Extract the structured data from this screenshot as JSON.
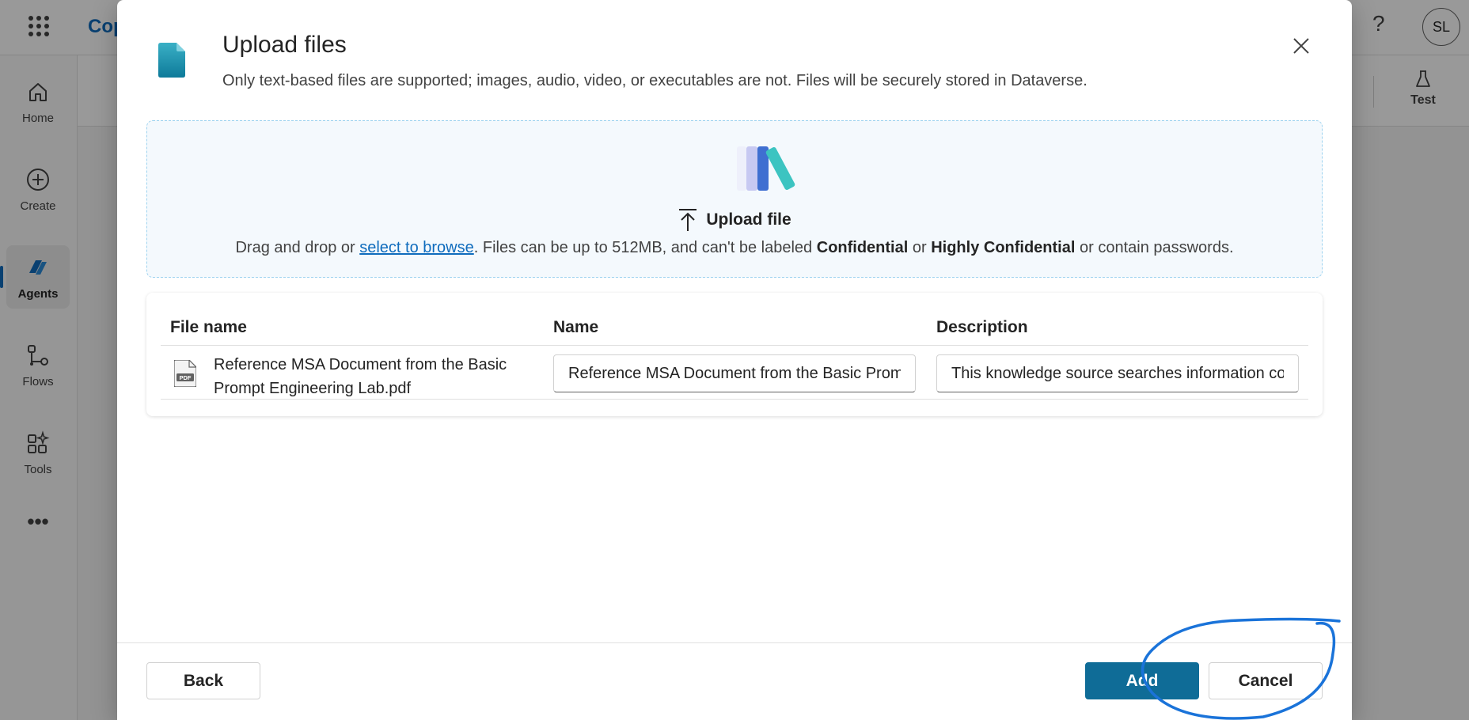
{
  "app": {
    "name": "Cop",
    "user_initials": "SL",
    "test_label": "Test"
  },
  "nav": {
    "items": [
      {
        "label": "Home",
        "icon": "home-icon"
      },
      {
        "label": "Create",
        "icon": "plus-circle-icon"
      },
      {
        "label": "Agents",
        "icon": "agents-icon"
      },
      {
        "label": "Flows",
        "icon": "flows-icon"
      },
      {
        "label": "Tools",
        "icon": "tools-icon"
      },
      {
        "label": "",
        "icon": "more-icon"
      }
    ],
    "active": "Agents"
  },
  "dialog": {
    "title": "Upload files",
    "subtitle": "Only text-based files are supported; images, audio, video, or executables are not. Files will be securely stored in Dataverse.",
    "dropzone": {
      "upload_label": "Upload file",
      "hint_prefix": "Drag and drop or ",
      "browse_link": "select to browse",
      "hint_middle": ". Files can be up to 512MB, and can't be labeled ",
      "confidential": "Confidential",
      "or": " or ",
      "highly_confidential": "Highly Confidential",
      "hint_suffix": " or contain passwords."
    },
    "table": {
      "headers": [
        "File name",
        "Name",
        "Description"
      ],
      "rows": [
        {
          "file_name": "Reference MSA Document from the Basic Prompt Engineering Lab.pdf",
          "name": "Reference MSA Document from the Basic Prompt Engineering Lab",
          "description": "This knowledge source searches information contained in Reference MSA Document from the Basic Prompt Engineering Lab"
        }
      ]
    },
    "buttons": {
      "back": "Back",
      "add": "Add",
      "cancel": "Cancel"
    }
  },
  "colors": {
    "accent": "#0f6c97",
    "link": "#0f6cbd",
    "annotation": "#1a73d9"
  }
}
